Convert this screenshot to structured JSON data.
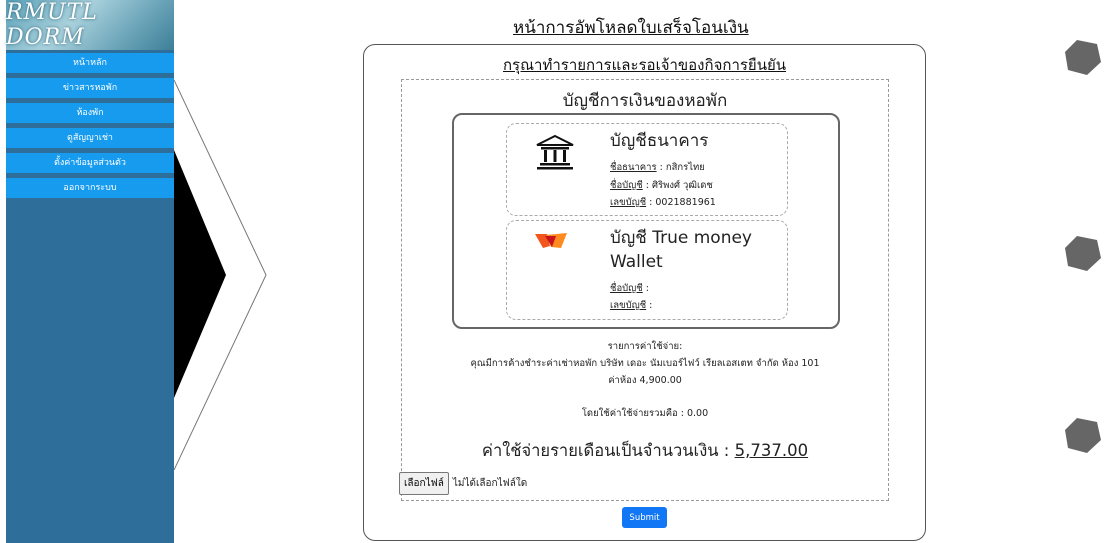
{
  "sidebar": {
    "logo_text": "RMUTL DORM",
    "items": [
      {
        "label": "หน้าหลัก"
      },
      {
        "label": "ข่าวสารหอพัก"
      },
      {
        "label": "ห้องพัก"
      },
      {
        "label": "ดูสัญญาเช่า"
      },
      {
        "label": "ตั้งค่าข้อมูลส่วนตัว"
      },
      {
        "label": "ออกจากระบบ"
      }
    ]
  },
  "page": {
    "title": "หน้าการอัพโหลดใบเสร็จโอนเงิน",
    "subtitle": "กรุณาทำรายการและรอเจ้าของกิจการยืนยัน",
    "accounts_heading": "บัญชีการเงินของหอพัก"
  },
  "bank": {
    "title": "บัญชีธนาคาร",
    "bank_name_label": "ชื่อธนาคาร",
    "bank_name": " : กสิกรไทย",
    "account_name_label": "ชื่อบัญชี",
    "account_name": " : ศิริพงศ์ วุฒิเดช",
    "account_no_label": "เลขบัญชี",
    "account_no": " : 0021881961"
  },
  "wallet": {
    "title_line1": "บัญชี True money",
    "title_line2": "Wallet",
    "account_name_label": "ชื่อบัญชี",
    "account_name": " :",
    "account_no_label": "เลขบัญชี",
    "account_no": " :"
  },
  "expenses": {
    "heading": "รายการค่าใช้จ่าย:",
    "detail": "คุณมีการค้างชำระค่าเช่าหอพัก บริษัท เดอะ นัมเบอร์ไฟว์ เรียลเอสเตท จำกัด ห้อง 101",
    "room_fee": "ค่าห้อง 4,900.00",
    "total_expense": "โดยใช้ค่าใช้จ่ายรวมคือ : 0.00",
    "monthly_label": "ค่าใช้จ่ายรายเดือนเป็นจำนวนเงิน : ",
    "monthly_amount": "5,737.00"
  },
  "upload": {
    "choose_file_label": "เลือกไฟล์",
    "no_file_text": "ไม่ได้เลือกไฟล์ใด",
    "submit_label": "Submit"
  },
  "colors": {
    "sidebar_bg": "#2e6e9b",
    "menu_item_bg": "#169bef",
    "submit_bg": "#1277f5"
  }
}
